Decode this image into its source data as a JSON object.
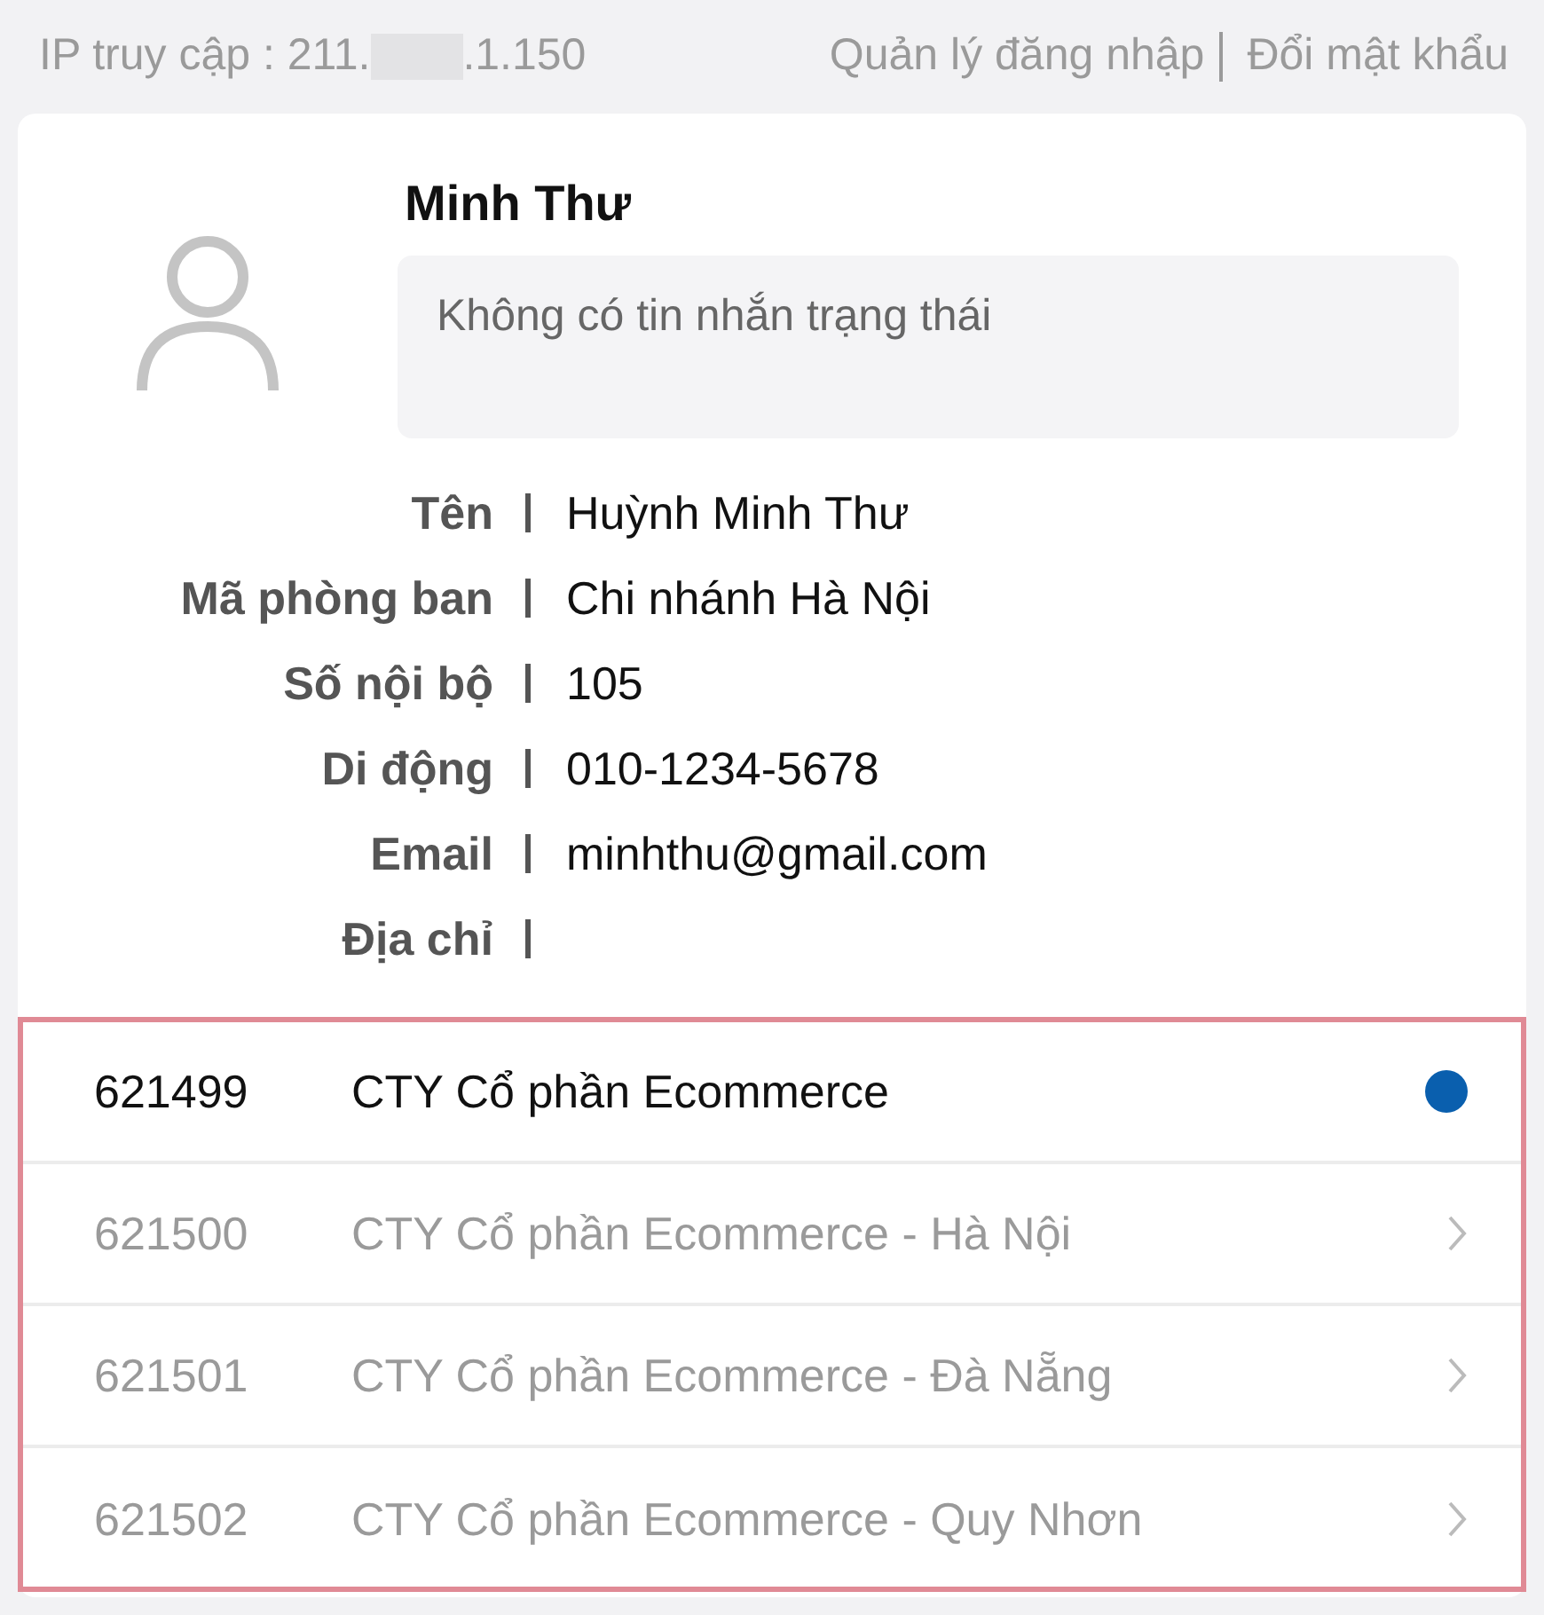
{
  "top_bar": {
    "ip": {
      "prefix": "IP truy cập : 211.",
      "masked": true,
      "suffix": ".1.150"
    },
    "links": [
      "Quản lý đăng nhập",
      "Đổi mật khẩu"
    ]
  },
  "profile": {
    "display_name": "Minh Thư",
    "status_message": "Không có tin nhắn trạng thái",
    "fields": [
      {
        "label": "Tên",
        "value": "Huỳnh Minh Thư"
      },
      {
        "label": "Mã phòng ban",
        "value": "Chi nhánh Hà Nội"
      },
      {
        "label": "Số nội bộ",
        "value": "105"
      },
      {
        "label": "Di động",
        "value": "010-1234-5678"
      },
      {
        "label": "Email",
        "value": "minhthu@gmail.com"
      },
      {
        "label": "Địa chỉ"
      }
    ]
  },
  "companies": [
    {
      "code": "621499",
      "name": "CTY Cổ phần Ecommerce",
      "selected": true
    },
    {
      "code": "621500",
      "name": "CTY Cổ phần Ecommerce - Hà Nội",
      "selected": false
    },
    {
      "code": "621501",
      "name": "CTY Cổ phần Ecommerce - Đà Nẵng",
      "selected": false
    },
    {
      "code": "621502",
      "name": "CTY Cổ phần Ecommerce - Quy Nhơn",
      "selected": false
    }
  ]
}
